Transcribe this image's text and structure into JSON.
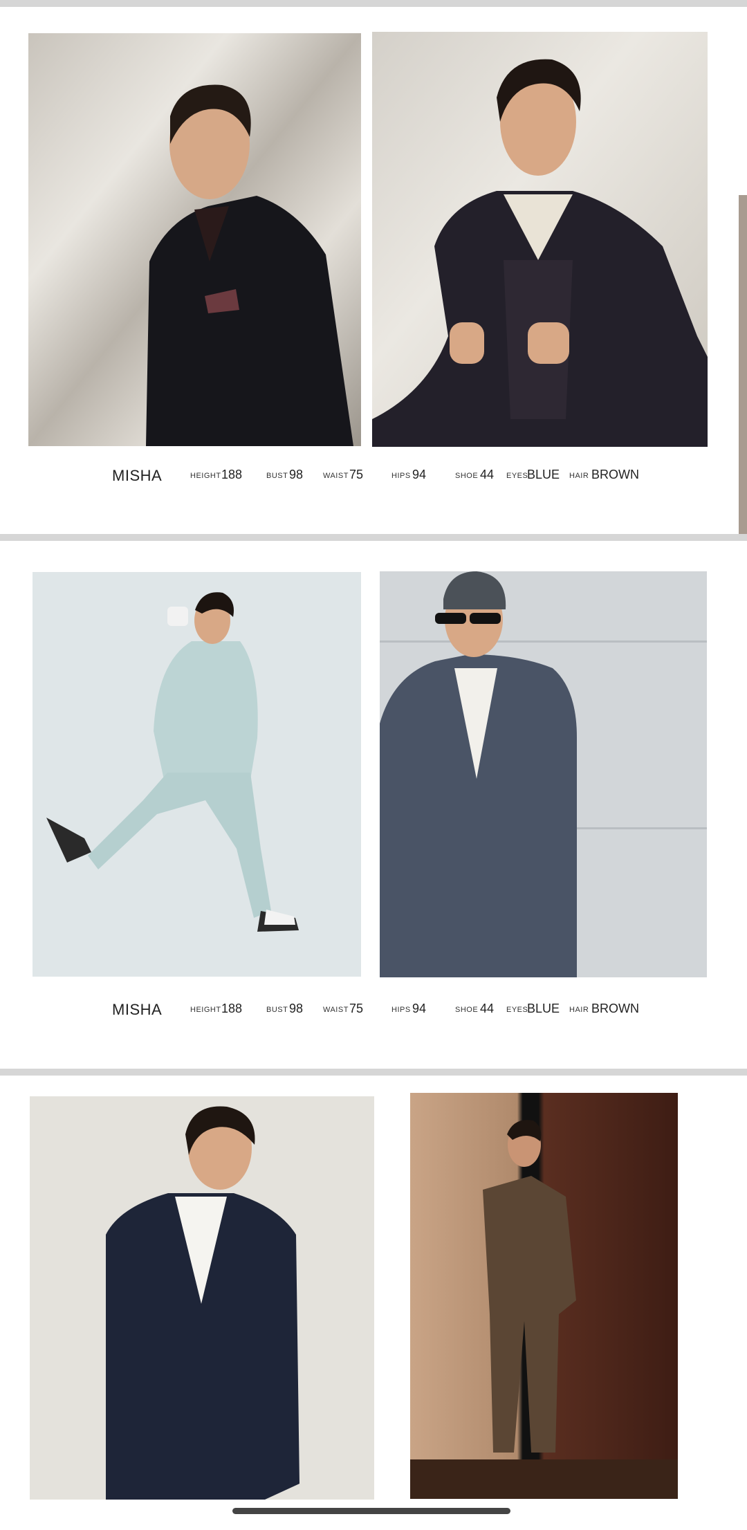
{
  "model_sheets": [
    {
      "name": "MISHA",
      "stats": [
        {
          "label": "HEIGHT",
          "value": "188"
        },
        {
          "label": "BUST",
          "value": "98"
        },
        {
          "label": "WAIST",
          "value": "75"
        },
        {
          "label": "HIPS",
          "value": "94"
        },
        {
          "label": "SHOE",
          "value": "44"
        },
        {
          "label": "EYES",
          "value": "BLUE"
        },
        {
          "label": "HAIR",
          "value": "BROWN"
        }
      ]
    },
    {
      "name": "MISHA",
      "stats": [
        {
          "label": "HEIGHT",
          "value": "188"
        },
        {
          "label": "BUST",
          "value": "98"
        },
        {
          "label": "WAIST",
          "value": "75"
        },
        {
          "label": "HIPS",
          "value": "94"
        },
        {
          "label": "SHOE",
          "value": "44"
        },
        {
          "label": "EYES",
          "value": "BLUE"
        },
        {
          "label": "HAIR",
          "value": "BROWN"
        }
      ]
    }
  ],
  "photos": [
    {
      "subject": "model in dark blazer with pocket square"
    },
    {
      "subject": "model in dark check suit and vest"
    },
    {
      "subject": "model in light mint suit walking with coffee cup"
    },
    {
      "subject": "model in grey overcoat with beanie and sunglasses"
    },
    {
      "subject": "model in navy blazer and white tee"
    },
    {
      "subject": "model in brown double-breasted suit against wood wall"
    }
  ]
}
